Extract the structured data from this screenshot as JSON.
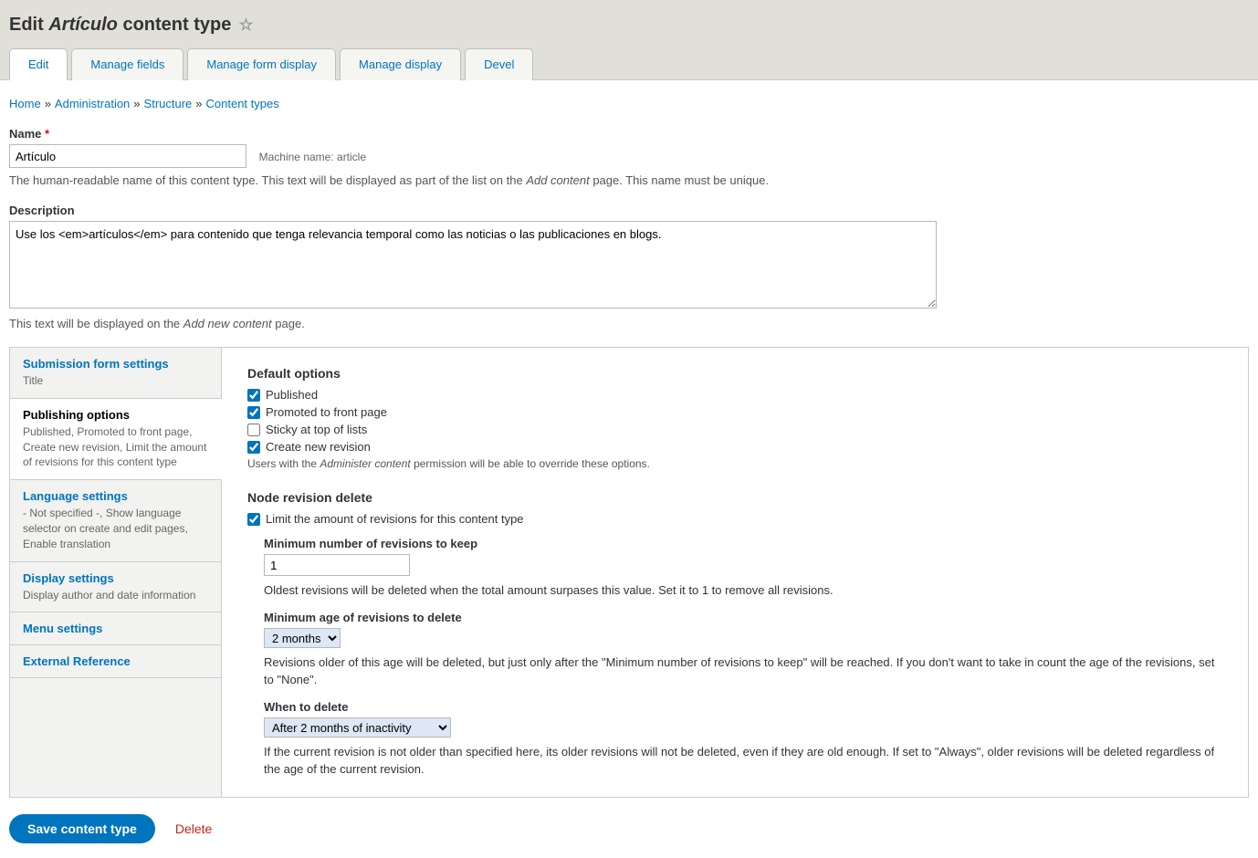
{
  "page": {
    "title_prefix": "Edit",
    "title_em": "Artículo",
    "title_suffix": "content type"
  },
  "tabs": [
    {
      "label": "Edit",
      "active": true
    },
    {
      "label": "Manage fields"
    },
    {
      "label": "Manage form display"
    },
    {
      "label": "Manage display"
    },
    {
      "label": "Devel"
    }
  ],
  "breadcrumb": {
    "items": [
      "Home",
      "Administration",
      "Structure",
      "Content types"
    ]
  },
  "name_field": {
    "label": "Name",
    "value": "Artículo",
    "machine_label": "Machine name:",
    "machine_value": "article",
    "help_pre": "The human-readable name of this content type. This text will be displayed as part of the list on the ",
    "help_em": "Add content",
    "help_post": " page. This name must be unique."
  },
  "desc_field": {
    "label": "Description",
    "value": "Use los <em>artículos</em> para contenido que tenga relevancia temporal como las noticias o las publicaciones en blogs.",
    "help_pre": "This text will be displayed on the ",
    "help_em": "Add new content",
    "help_post": " page."
  },
  "vtabs": [
    {
      "title": "Submission form settings",
      "summary": "Title"
    },
    {
      "title": "Publishing options",
      "summary": "Published, Promoted to front page, Create new revision, Limit the amount of revisions for this content type",
      "active": true
    },
    {
      "title": "Language settings",
      "summary": "- Not specified -, Show language selector on create and edit pages, Enable translation"
    },
    {
      "title": "Display settings",
      "summary": "Display author and date information"
    },
    {
      "title": "Menu settings",
      "summary": ""
    },
    {
      "title": "External Reference",
      "summary": ""
    }
  ],
  "publishing": {
    "default_options_label": "Default options",
    "options": [
      {
        "label": "Published",
        "checked": true
      },
      {
        "label": "Promoted to front page",
        "checked": true
      },
      {
        "label": "Sticky at top of lists",
        "checked": false
      },
      {
        "label": "Create new revision",
        "checked": true
      }
    ],
    "options_help_pre": "Users with the ",
    "options_help_em": "Administer content",
    "options_help_post": " permission will be able to override these options.",
    "revision_delete_label": "Node revision delete",
    "limit": {
      "label": "Limit the amount of revisions for this content type",
      "checked": true
    },
    "min_keep": {
      "label": "Minimum number of revisions to keep",
      "value": "1",
      "help": "Oldest revisions will be deleted when the total amount surpases this value. Set it to 1 to remove all revisions."
    },
    "min_age": {
      "label": "Minimum age of revisions to delete",
      "value": "2 months",
      "help": "Revisions older of this age will be deleted, but just only after the \"Minimum number of revisions to keep\" will be reached. If you don't want to take in count the age of the revisions, set to \"None\"."
    },
    "when_delete": {
      "label": "When to delete",
      "value": "After 2 months of inactivity",
      "help": "If the current revision is not older than specified here, its older revisions will not be deleted, even if they are old enough. If set to \"Always\", older revisions will be deleted regardless of the age of the current revision."
    }
  },
  "actions": {
    "save": "Save content type",
    "delete": "Delete"
  }
}
